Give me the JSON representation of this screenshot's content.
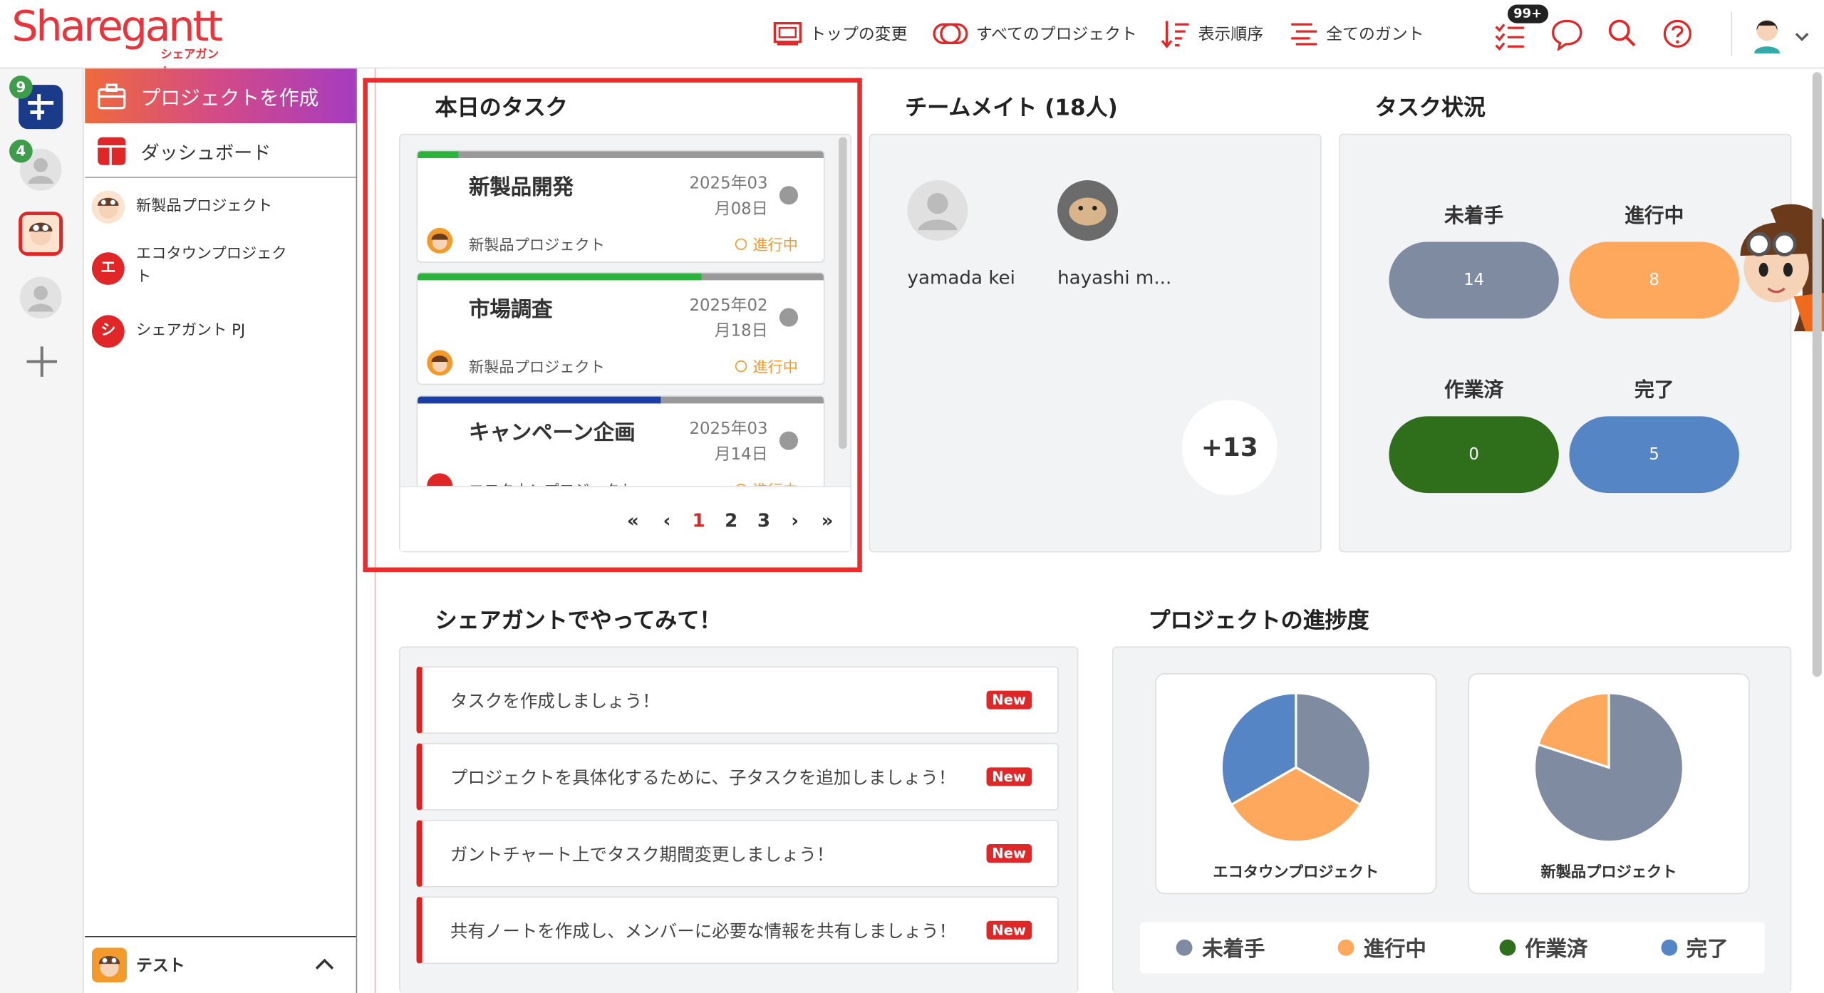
{
  "header": {
    "logo_main": "Sharegantt",
    "logo_sub": "シェアガント",
    "nav": [
      {
        "label": "トップの変更",
        "icon": "monitor-icon"
      },
      {
        "label": "すべてのプロジェクト",
        "icon": "projects-icon"
      },
      {
        "label": "表示順序",
        "icon": "sort-icon"
      },
      {
        "label": "全てのガント",
        "icon": "gantt-icon"
      }
    ],
    "badge": "99+"
  },
  "rail": {
    "badge_1": "9",
    "badge_2": "4"
  },
  "sidebar": {
    "create_label": "プロジェクトを作成",
    "dashboard_label": "ダッシュボード",
    "projects": [
      {
        "name": "新製品プロジェクト",
        "initial": "",
        "color": "#f39a2c"
      },
      {
        "name": "エコタウンプロジェクト",
        "initial": "エ",
        "color": "#e02626"
      },
      {
        "name": "シェアガント PJ",
        "initial": "シ",
        "color": "#e02626"
      }
    ],
    "footer_label": "テスト"
  },
  "tasks": {
    "title": "本日のタスク",
    "items": [
      {
        "name": "新製品開発",
        "date_1": "2025年03",
        "date_2": "月08日",
        "project": "新製品プロジェクト",
        "status": "進行中",
        "progress": 0.1,
        "bar_color": "#2db23b"
      },
      {
        "name": "市場調査",
        "date_1": "2025年02",
        "date_2": "月18日",
        "project": "新製品プロジェクト",
        "status": "進行中",
        "progress": 0.7,
        "bar_color": "#2db23b"
      },
      {
        "name": "キャンペーン企画",
        "date_1": "2025年03",
        "date_2": "月14日",
        "project": "エコタウンプロジェクト",
        "status": "進行中",
        "progress": 0.6,
        "bar_color": "#1a3ea8"
      }
    ],
    "pager": {
      "first": "«",
      "prev": "‹",
      "pages": [
        "1",
        "2",
        "3"
      ],
      "current": "1",
      "next": "›",
      "last": "»"
    }
  },
  "team": {
    "title": "チームメイト (18人)",
    "members": [
      {
        "name": "yamada kei"
      },
      {
        "name": "hayashi m..."
      }
    ],
    "more": "+13"
  },
  "status": {
    "title": "タスク状況",
    "items": [
      {
        "label": "未着手",
        "value": "14",
        "color": "#7f8ba0"
      },
      {
        "label": "進行中",
        "value": "8",
        "color": "#fda85d"
      },
      {
        "label": "作業済",
        "value": "0",
        "color": "#2f6e1a"
      },
      {
        "label": "完了",
        "value": "5",
        "color": "#5685c6"
      }
    ]
  },
  "tips": {
    "title": "シェアガントでやってみて！",
    "items": [
      {
        "text": "タスクを作成しましょう！",
        "badge": "New"
      },
      {
        "text": "プロジェクトを具体化するために、子タスクを追加しましょう！",
        "badge": "New"
      },
      {
        "text": "ガントチャート上でタスク期間変更しましょう！",
        "badge": "New"
      },
      {
        "text": "共有ノートを作成し、メンバーに必要な情報を共有しましょう！",
        "badge": "New"
      }
    ]
  },
  "progress": {
    "title": "プロジェクトの進捗度",
    "legend": [
      {
        "label": "未着手",
        "color": "#7f8ba0"
      },
      {
        "label": "進行中",
        "color": "#fda85d"
      },
      {
        "label": "作業済",
        "color": "#2f6e1a"
      },
      {
        "label": "完了",
        "color": "#5685c6"
      }
    ]
  },
  "chart_data": [
    {
      "type": "pie",
      "title": "エコタウンプロジェクト",
      "categories": [
        "未着手",
        "進行中",
        "作業済",
        "完了"
      ],
      "values": [
        1,
        1,
        0,
        1
      ],
      "colors": [
        "#7f8ba0",
        "#fda85d",
        "#2f6e1a",
        "#5685c6"
      ]
    },
    {
      "type": "pie",
      "title": "新製品プロジェクト",
      "categories": [
        "未着手",
        "進行中",
        "作業済",
        "完了"
      ],
      "values": [
        4,
        1,
        0,
        0
      ],
      "colors": [
        "#7f8ba0",
        "#fda85d",
        "#2f6e1a",
        "#5685c6"
      ]
    }
  ]
}
